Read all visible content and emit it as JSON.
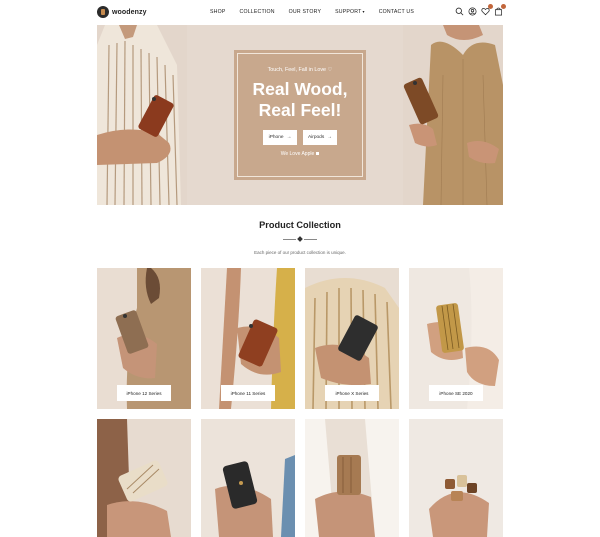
{
  "brand": {
    "name": "woodenzy"
  },
  "nav": {
    "items": [
      {
        "label": "SHOP"
      },
      {
        "label": "COLLECTION"
      },
      {
        "label": "OUR STORY"
      },
      {
        "label": "SUPPORT",
        "has_dropdown": true
      },
      {
        "label": "CONTACT US"
      }
    ]
  },
  "header_icons": [
    "search-icon",
    "account-icon",
    "wishlist-icon",
    "cart-icon"
  ],
  "hero": {
    "kicker": "Touch, Feel, Fall in Love ♡",
    "title_line1": "Real Wood,",
    "title_line2": "Real Feel!",
    "buttons": [
      {
        "label": "iPhone",
        "arrow": "→"
      },
      {
        "label": "Airpods",
        "arrow": "→"
      }
    ],
    "link": "We Love Apple"
  },
  "collection": {
    "title": "Product Collection",
    "subtitle": "Each piece of our product collection is unique.",
    "cards": [
      {
        "label": "iPhone 12 Series"
      },
      {
        "label": "iPhone 11 Series"
      },
      {
        "label": "iPhone X Series"
      },
      {
        "label": "iPhone SE 2020"
      }
    ]
  },
  "colors": {
    "accent": "#c2663b",
    "hero_bg": "#e5d9cf",
    "hero_box": "#c8a88d"
  }
}
